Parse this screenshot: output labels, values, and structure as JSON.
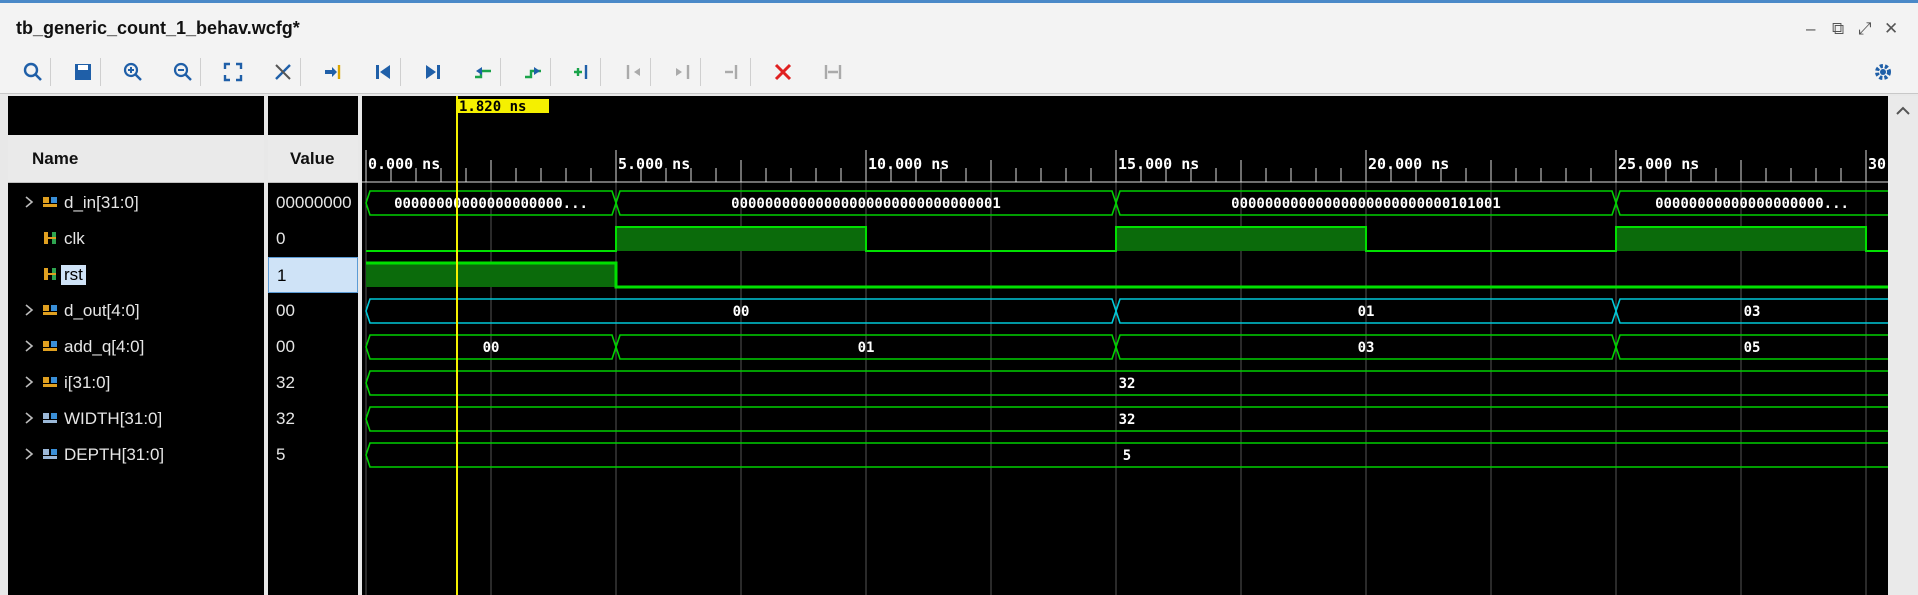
{
  "window": {
    "title": "tb_generic_count_1_behav.wcfg*",
    "min": "–",
    "restore": "⧉",
    "max": "⤢",
    "close": "✕"
  },
  "toolbar": {
    "items": [
      {
        "name": "search-icon"
      },
      {
        "name": "save-icon"
      },
      {
        "name": "zoom-in-icon"
      },
      {
        "name": "zoom-out-icon"
      },
      {
        "name": "zoom-fit-icon"
      },
      {
        "name": "cursor-snap-icon"
      },
      {
        "name": "goto-cursor-icon"
      },
      {
        "name": "goto-time-zero-icon"
      },
      {
        "name": "goto-last-time-icon"
      },
      {
        "name": "prev-transition-icon"
      },
      {
        "name": "next-transition-icon"
      },
      {
        "name": "add-marker-icon"
      },
      {
        "name": "prev-marker-icon"
      },
      {
        "name": "next-marker-icon"
      },
      {
        "name": "swap-cursors-icon"
      },
      {
        "name": "delete-marker-icon"
      },
      {
        "name": "fit-markers-icon"
      }
    ],
    "settings_icon": "gear-icon"
  },
  "columns": {
    "name": "Name",
    "value": "Value"
  },
  "cursor": {
    "label": "1.820 ns",
    "time_ns": 1.82
  },
  "timescale": {
    "start_ns": 0,
    "end_ns": 30.5,
    "labels": [
      "0.000 ns",
      "5.000 ns",
      "10.000 ns",
      "15.000 ns",
      "20.000 ns",
      "25.000 ns",
      "30"
    ]
  },
  "signals": [
    {
      "name": "d_in[31:0]",
      "value": "00000000",
      "expandable": true,
      "icon": "bus-icon",
      "segments": [
        {
          "t0": 0,
          "t1": 5,
          "text": "00000000000000000000..."
        },
        {
          "t0": 5,
          "t1": 15,
          "text": "00000000000000000000000000000001"
        },
        {
          "t0": 15,
          "t1": 25,
          "text": "00000000000000000000000000101001"
        },
        {
          "t0": 25,
          "t1": 31,
          "text": "00000000000000000000..."
        }
      ]
    },
    {
      "name": "clk",
      "value": "0",
      "expandable": false,
      "icon": "bit-icon",
      "levels": [
        {
          "t": 0,
          "v": 0
        },
        {
          "t": 5,
          "v": 1
        },
        {
          "t": 10,
          "v": 0
        },
        {
          "t": 15,
          "v": 1
        },
        {
          "t": 20,
          "v": 0
        },
        {
          "t": 25,
          "v": 1
        },
        {
          "t": 30,
          "v": 0
        }
      ]
    },
    {
      "name": "rst",
      "value": "1",
      "expandable": false,
      "icon": "bit-icon",
      "selected": true,
      "levels": [
        {
          "t": 0,
          "v": 1
        },
        {
          "t": 5,
          "v": 0
        }
      ]
    },
    {
      "name": "d_out[4:0]",
      "value": "00",
      "expandable": true,
      "icon": "bus-icon",
      "color": "#00c8d8",
      "segments": [
        {
          "t0": 0,
          "t1": 15,
          "text": "00"
        },
        {
          "t0": 15,
          "t1": 25,
          "text": "01"
        },
        {
          "t0": 25,
          "t1": 31,
          "text": "03"
        }
      ]
    },
    {
      "name": "add_q[4:0]",
      "value": "00",
      "expandable": true,
      "icon": "bus-icon",
      "segments": [
        {
          "t0": 0,
          "t1": 5,
          "text": "00"
        },
        {
          "t0": 5,
          "t1": 15,
          "text": "01"
        },
        {
          "t0": 15,
          "t1": 25,
          "text": "03"
        },
        {
          "t0": 25,
          "t1": 31,
          "text": "05"
        }
      ]
    },
    {
      "name": "i[31:0]",
      "value": "32",
      "expandable": true,
      "icon": "bus-icon",
      "segments": [
        {
          "t0": 0,
          "t1": 31,
          "text": "32"
        }
      ]
    },
    {
      "name": "WIDTH[31:0]",
      "value": "32",
      "expandable": true,
      "icon": "param-icon",
      "segments": [
        {
          "t0": 0,
          "t1": 31,
          "text": "32"
        }
      ]
    },
    {
      "name": "DEPTH[31:0]",
      "value": "5",
      "expandable": true,
      "icon": "param-icon",
      "segments": [
        {
          "t0": 0,
          "t1": 31,
          "text": "5"
        }
      ]
    }
  ]
}
